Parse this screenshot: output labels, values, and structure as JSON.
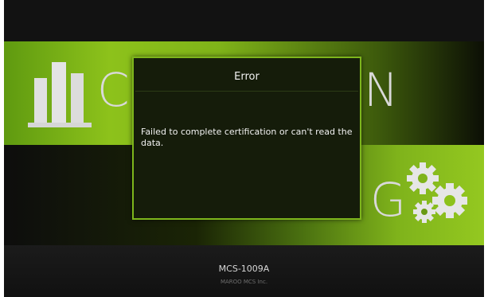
{
  "window": {
    "banner_letters": {
      "top_left": "C",
      "top_right": "N",
      "bottom_right": "G"
    },
    "logo_icon": "bar-chart-icon",
    "decor_icon": "gears-icon"
  },
  "dialog": {
    "title": "Error",
    "message": "Failed to complete certification or can't read the data."
  },
  "footer": {
    "model": "MCS-1009A",
    "company": "MAROO MCS Inc."
  },
  "colors": {
    "accent_green": "#8dc21b",
    "dialog_border": "#7db51c",
    "dialog_background": "#151c0a"
  }
}
